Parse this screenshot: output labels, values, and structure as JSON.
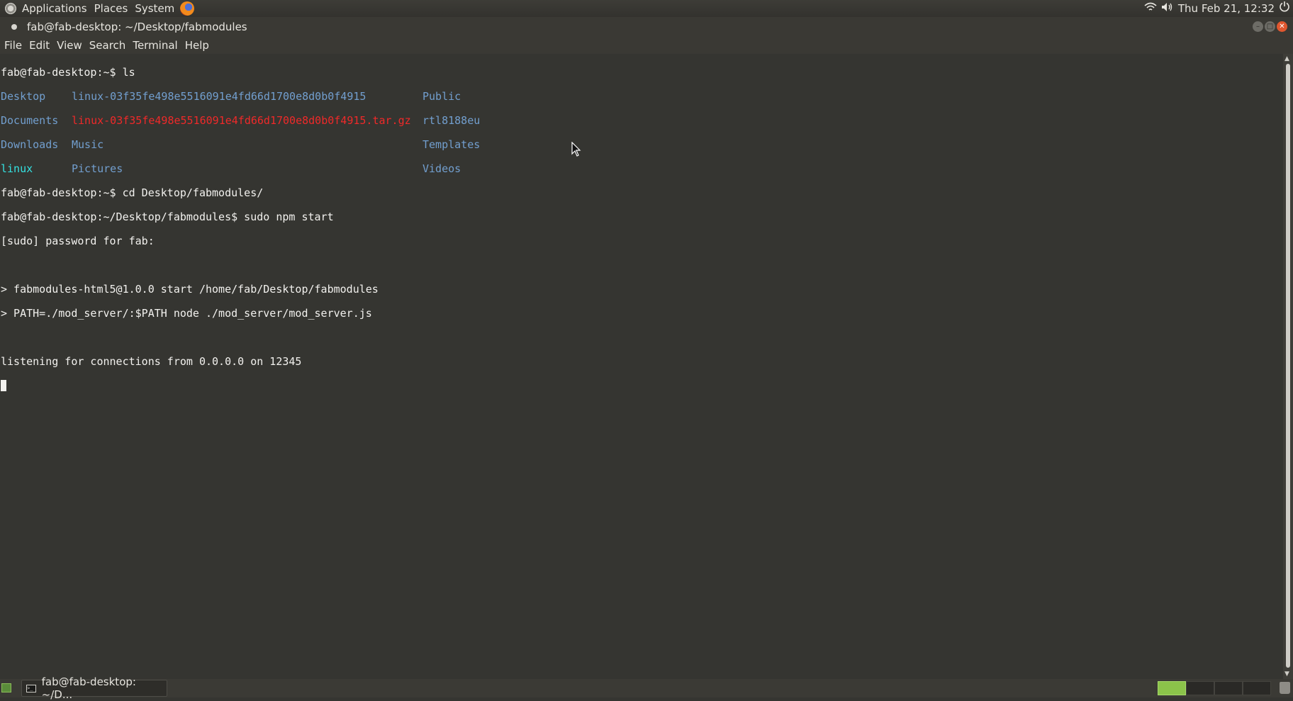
{
  "top_panel": {
    "menus": [
      "Applications",
      "Places",
      "System"
    ],
    "clock": "Thu Feb 21, 12:32"
  },
  "window": {
    "title": "fab@fab-desktop: ~/Desktop/fabmodules",
    "menu": [
      "File",
      "Edit",
      "View",
      "Search",
      "Terminal",
      "Help"
    ]
  },
  "terminal": {
    "lines": {
      "l1": "fab@fab-desktop:~$ ls",
      "l6": "fab@fab-desktop:~$ cd Desktop/fabmodules/",
      "l7": "fab@fab-desktop:~/Desktop/fabmodules$ sudo npm start",
      "l8": "[sudo] password for fab:",
      "l10": "> fabmodules-html5@1.0.0 start /home/fab/Desktop/fabmodules",
      "l11": "> PATH=./mod_server/:$PATH node ./mod_server/mod_server.js",
      "l13": "listening for connections from 0.0.0.0 on 12345"
    },
    "ls": {
      "r1": [
        "Desktop",
        "linux-03f35fe498e5516091e4fd66d1700e8d0b0f4915",
        "Public"
      ],
      "r2": [
        "Documents",
        "linux-03f35fe498e5516091e4fd66d1700e8d0b0f4915.tar.gz",
        "rtl8188eu"
      ],
      "r3": [
        "Downloads",
        "Music",
        "Templates"
      ],
      "r4": [
        "linux",
        "Pictures",
        "Videos"
      ]
    }
  },
  "bottom_panel": {
    "task_label": "fab@fab-desktop: ~/D..."
  },
  "colors": {
    "terminal_bg": "#353531",
    "directory": "#729fcf",
    "archive": "#ef2929",
    "symlink": "#34e2e2",
    "active_workspace": "#8bc34a"
  },
  "icons": [
    "distro-logo-icon",
    "firefox-icon",
    "wifi-icon",
    "volume-icon",
    "power-icon",
    "terminal-icon",
    "trash-icon",
    "mouse-pointer-icon"
  ]
}
